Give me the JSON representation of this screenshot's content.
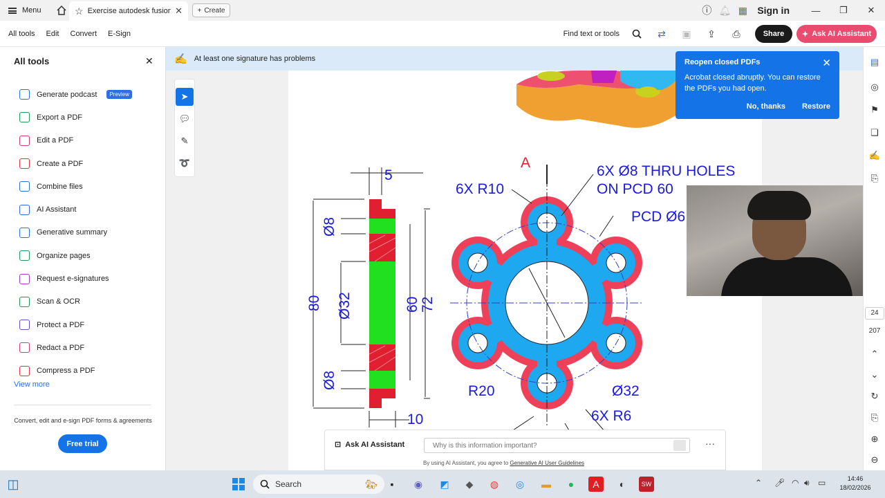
{
  "titlebar": {
    "menu_label": "Menu",
    "tab_title": "Exercise autodesk fusion...",
    "create_label": "Create",
    "signin_label": "Sign in"
  },
  "toolbar": {
    "menu": [
      "All tools",
      "Edit",
      "Convert",
      "E-Sign"
    ],
    "find_label": "Find text or tools",
    "share_label": "Share",
    "ai_label": "Ask AI Assistant"
  },
  "left_panel": {
    "title": "All tools",
    "items": [
      {
        "label": "Generate podcast",
        "color": "#2d6fe0",
        "badge": "Preview"
      },
      {
        "label": "Export a PDF",
        "color": "#1b9a54"
      },
      {
        "label": "Edit a PDF",
        "color": "#d6396b"
      },
      {
        "label": "Create a PDF",
        "color": "#e0343f"
      },
      {
        "label": "Combine files",
        "color": "#2d6fe0"
      },
      {
        "label": "AI Assistant",
        "color": "#2d6fe0"
      },
      {
        "label": "Generative summary",
        "color": "#2d6fe0"
      },
      {
        "label": "Organize pages",
        "color": "#1b9a54"
      },
      {
        "label": "Request e-signatures",
        "color": "#a43cc8"
      },
      {
        "label": "Scan & OCR",
        "color": "#1b9a54"
      },
      {
        "label": "Protect a PDF",
        "color": "#6a4cc8"
      },
      {
        "label": "Redact a PDF",
        "color": "#d6396b"
      },
      {
        "label": "Compress a PDF",
        "color": "#e0343f"
      }
    ],
    "view_more": "View more",
    "promo_text": "Convert, edit and e-sign PDF forms & agreements",
    "trial_label": "Free trial"
  },
  "banner": {
    "text": "At least one signature has problems"
  },
  "notification": {
    "title": "Reopen closed PDFs",
    "body": "Acrobat closed abruptly. You can restore the PDFs you had open.",
    "no_label": "No, thanks",
    "restore_label": "Restore"
  },
  "drawing": {
    "dim_5": "5",
    "dim_d8_top": "Ø8",
    "dim_d8_bottom": "Ø8",
    "dim_80": "80",
    "dim_d32": "Ø32",
    "dim_60": "60",
    "dim_72": "72",
    "dim_10": "10",
    "label_a": "A",
    "label_6xr10": "6X R10",
    "label_holes_1": "6X Ø8 THRU HOLES",
    "label_holes_2": "ON PCD 60",
    "label_pcd": "PCD Ø6",
    "label_r20": "R20",
    "label_d32": "Ø32",
    "label_6xr6": "6X R6"
  },
  "right_rail": {
    "page_current": "24",
    "page_total": "207"
  },
  "ai_bar": {
    "label": "Ask AI Assistant",
    "placeholder": "Why is this information important?",
    "legal_prefix": "By using AI Assistant, you agree to ",
    "legal_link": "Generative AI User Guidelines"
  },
  "taskbar": {
    "search_label": "Search",
    "time": "14:46",
    "date": "18/02/2026"
  }
}
